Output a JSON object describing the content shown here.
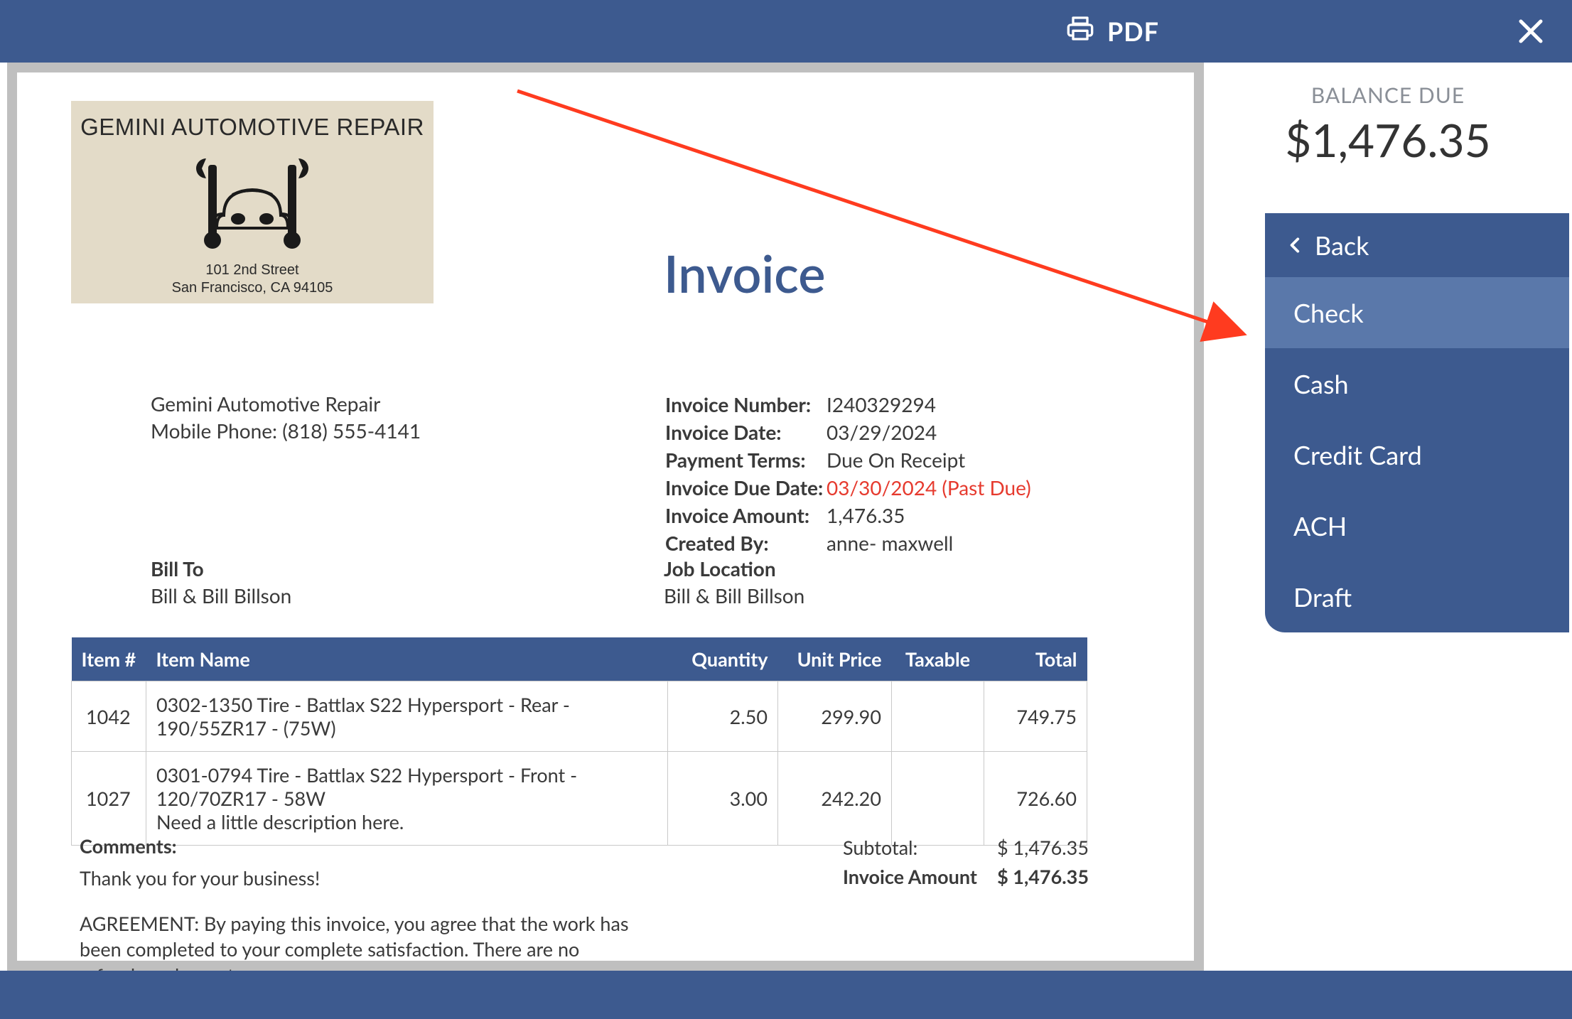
{
  "topbar": {
    "pdf_label": "PDF"
  },
  "company": {
    "card_name": "GEMINI AUTOMOTIVE REPAIR",
    "addr_line1": "101 2nd Street",
    "addr_line2": "San Francisco, CA  94105",
    "contact_name": "Gemini Automotive Repair",
    "contact_phone": "Mobile Phone: (818) 555-4141"
  },
  "doc_title": "Invoice",
  "meta": {
    "labels": {
      "invoice_number": "Invoice Number:",
      "invoice_date": "Invoice Date:",
      "payment_terms": "Payment Terms:",
      "invoice_due_date": "Invoice Due Date:",
      "invoice_amount": "Invoice Amount:",
      "created_by": "Created By:"
    },
    "values": {
      "invoice_number": "I240329294",
      "invoice_date": "03/29/2024",
      "payment_terms": "Due On Receipt",
      "invoice_due_date": "03/30/2024 (Past Due)",
      "invoice_amount": "1,476.35",
      "created_by": "anne- maxwell"
    }
  },
  "billto": {
    "heading": "Bill To",
    "value": "Bill & Bill Billson"
  },
  "jobloc": {
    "heading": "Job Location",
    "value": "Bill & Bill Billson"
  },
  "items_table": {
    "headers": {
      "item_no": "Item #",
      "item_name": "Item Name",
      "quantity": "Quantity",
      "unit_price": "Unit Price",
      "taxable": "Taxable",
      "total": "Total"
    },
    "rows": [
      {
        "item_no": "1042",
        "item_name": "0302-1350 Tire - Battlax S22 Hypersport - Rear - 190/55ZR17 - (75W)",
        "desc": "",
        "quantity": "2.50",
        "unit_price": "299.90",
        "taxable": "",
        "total": "749.75"
      },
      {
        "item_no": "1027",
        "item_name": "0301-0794 Tire - Battlax S22 Hypersport - Front - 120/70ZR17 - 58W",
        "desc": "Need a little description here.",
        "quantity": "3.00",
        "unit_price": "242.20",
        "taxable": "",
        "total": "726.60"
      }
    ]
  },
  "comments": {
    "heading": "Comments:",
    "thanks": "Thank you for your business!",
    "agreement": "AGREEMENT: By paying this invoice, you agree that the work has been completed to your complete satisfaction. There are no refunds and no returns."
  },
  "totals": {
    "subtotal_label": "Subtotal:",
    "subtotal_value": "$ 1,476.35",
    "invoice_amount_label": "Invoice Amount",
    "invoice_amount_value": "$ 1,476.35"
  },
  "sidebar": {
    "balance_due_label": "BALANCE DUE",
    "balance_due_value": "$1,476.35"
  },
  "pay_menu": {
    "back_label": "Back",
    "options": [
      "Check",
      "Cash",
      "Credit Card",
      "ACH",
      "Draft"
    ],
    "selected_index": 0
  }
}
